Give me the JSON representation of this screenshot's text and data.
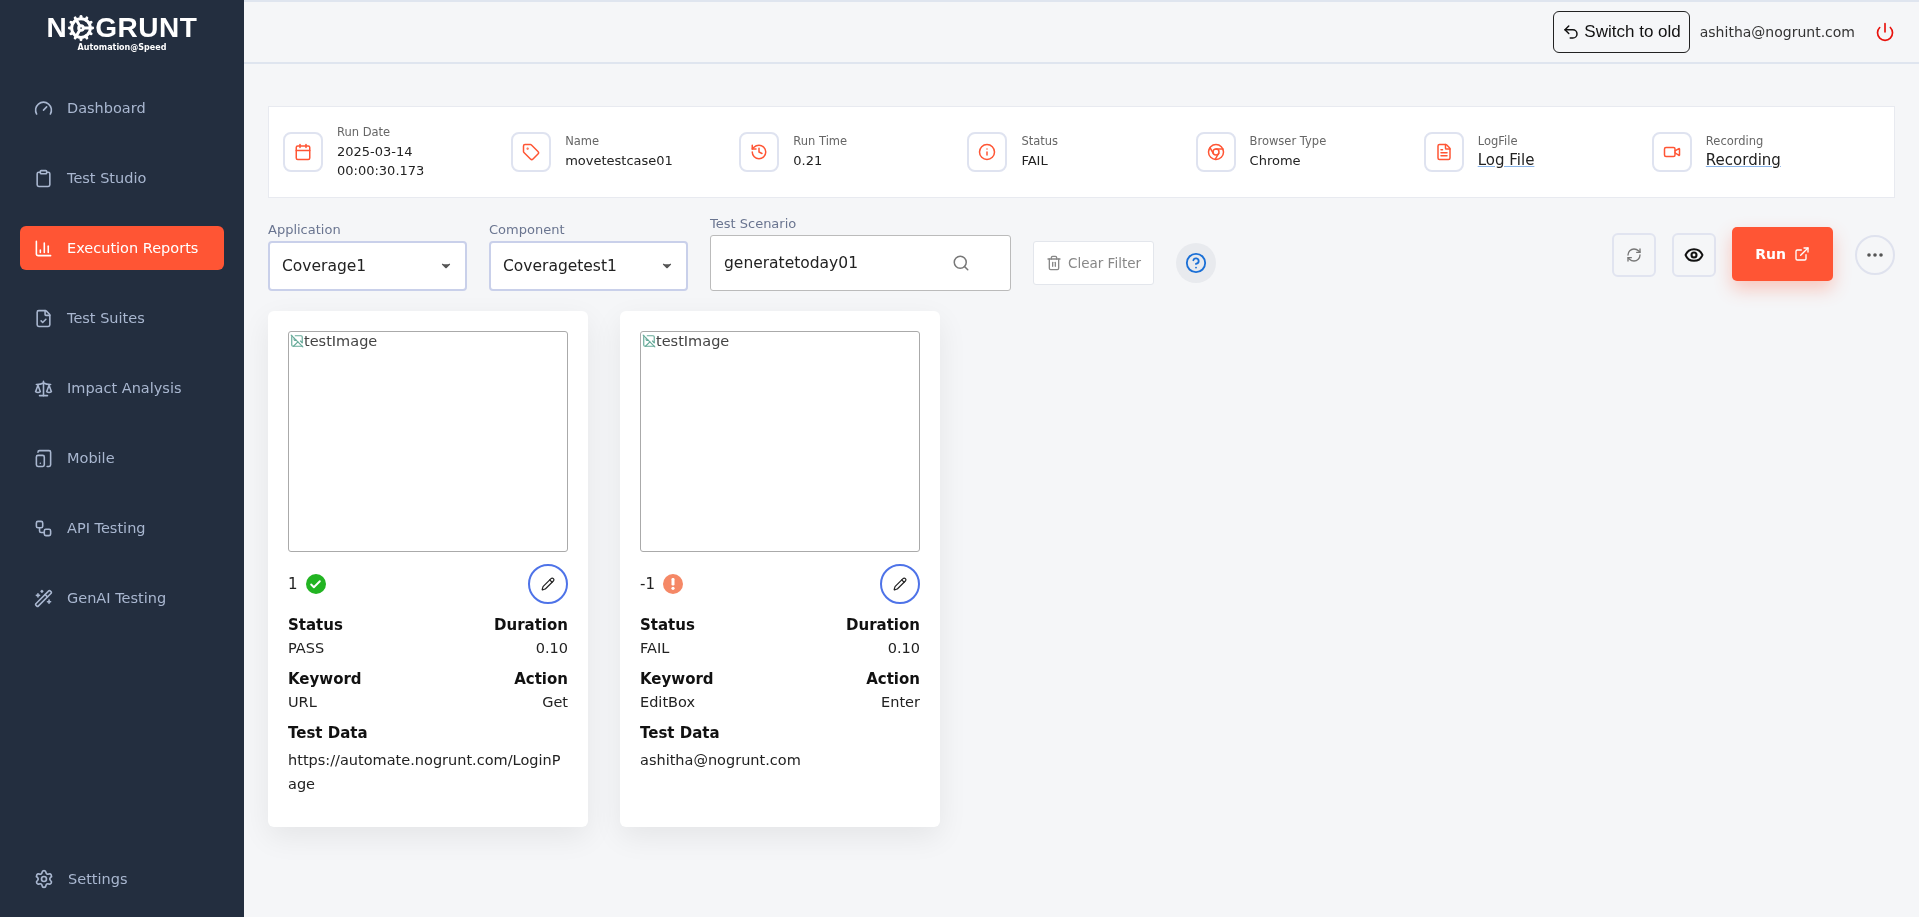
{
  "logo": {
    "prefix": "N",
    "suffix": "GRUNT",
    "tagline": "Automation@Speed"
  },
  "sidebar": {
    "items": [
      {
        "label": "Dashboard",
        "selected": false
      },
      {
        "label": "Test Studio",
        "selected": false
      },
      {
        "label": "Execution Reports",
        "selected": true
      },
      {
        "label": "Test Suites",
        "selected": false
      },
      {
        "label": "Impact Analysis",
        "selected": false
      },
      {
        "label": "Mobile",
        "selected": false
      },
      {
        "label": "API Testing",
        "selected": false
      },
      {
        "label": "GenAI Testing",
        "selected": false
      }
    ],
    "footer": {
      "label": "Settings",
      "selected": false
    }
  },
  "header": {
    "switch_button": "Switch to old",
    "user": "ashitha@nogrunt.com"
  },
  "info": [
    {
      "label": "Run Date",
      "value": "2025-03-14 00:00:30.173",
      "kind": "text"
    },
    {
      "label": "Name",
      "value": "movetestcase01",
      "kind": "text"
    },
    {
      "label": "Run Time",
      "value": "0.21",
      "kind": "text"
    },
    {
      "label": "Status",
      "value": "FAIL",
      "kind": "text"
    },
    {
      "label": "Browser Type",
      "value": "Chrome",
      "kind": "text"
    },
    {
      "label": "LogFile",
      "value": "Log File",
      "kind": "link"
    },
    {
      "label": "Recording",
      "value": "Recording",
      "kind": "link"
    }
  ],
  "filters": {
    "application": {
      "label": "Application",
      "value": "Coverage1"
    },
    "component": {
      "label": "Component",
      "value": "Coveragetest1"
    },
    "scenario": {
      "label": "Test Scenario",
      "value": "generatetoday01"
    },
    "clear": "Clear Filter",
    "run": "Run"
  },
  "cards": [
    {
      "image_alt": "testImage",
      "step": "1",
      "kind": "pass",
      "status_label": "Status",
      "status": "PASS",
      "duration_label": "Duration",
      "duration": "0.10",
      "keyword_label": "Keyword",
      "keyword": "URL",
      "action_label": "Action",
      "action": "Get",
      "data_label": "Test Data",
      "data": "https://automate.nogrunt.com/LoginPage"
    },
    {
      "image_alt": "testImage",
      "step": "-1",
      "kind": "fail",
      "status_label": "Status",
      "status": "FAIL",
      "duration_label": "Duration",
      "duration": "0.10",
      "keyword_label": "Keyword",
      "keyword": "EditBox",
      "action_label": "Action",
      "action": "Enter",
      "data_label": "Test Data",
      "data": "ashitha@nogrunt.com"
    }
  ]
}
